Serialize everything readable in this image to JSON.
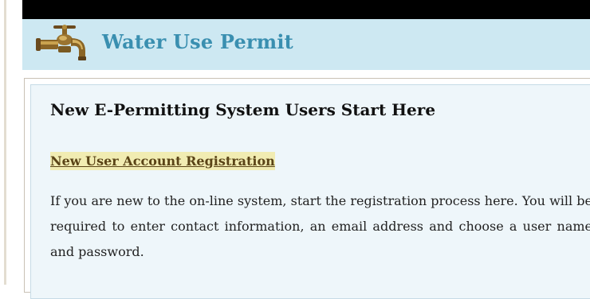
{
  "header": {
    "title": "Water Use Permit",
    "icon": "faucet-icon"
  },
  "panel": {
    "heading": "New E-Permitting System Users Start Here",
    "link_label": "New User Account Registration",
    "description": "If you are new to the on-line system, start the registration process here. You will be required to enter contact information, an email address and choose a user name and password."
  },
  "colors": {
    "header_bg": "#cde8f2",
    "header_title": "#3a8fb0",
    "panel_bg": "#eef6fa",
    "link_highlight": "#f1ecb2",
    "link_text": "#5a4417"
  }
}
